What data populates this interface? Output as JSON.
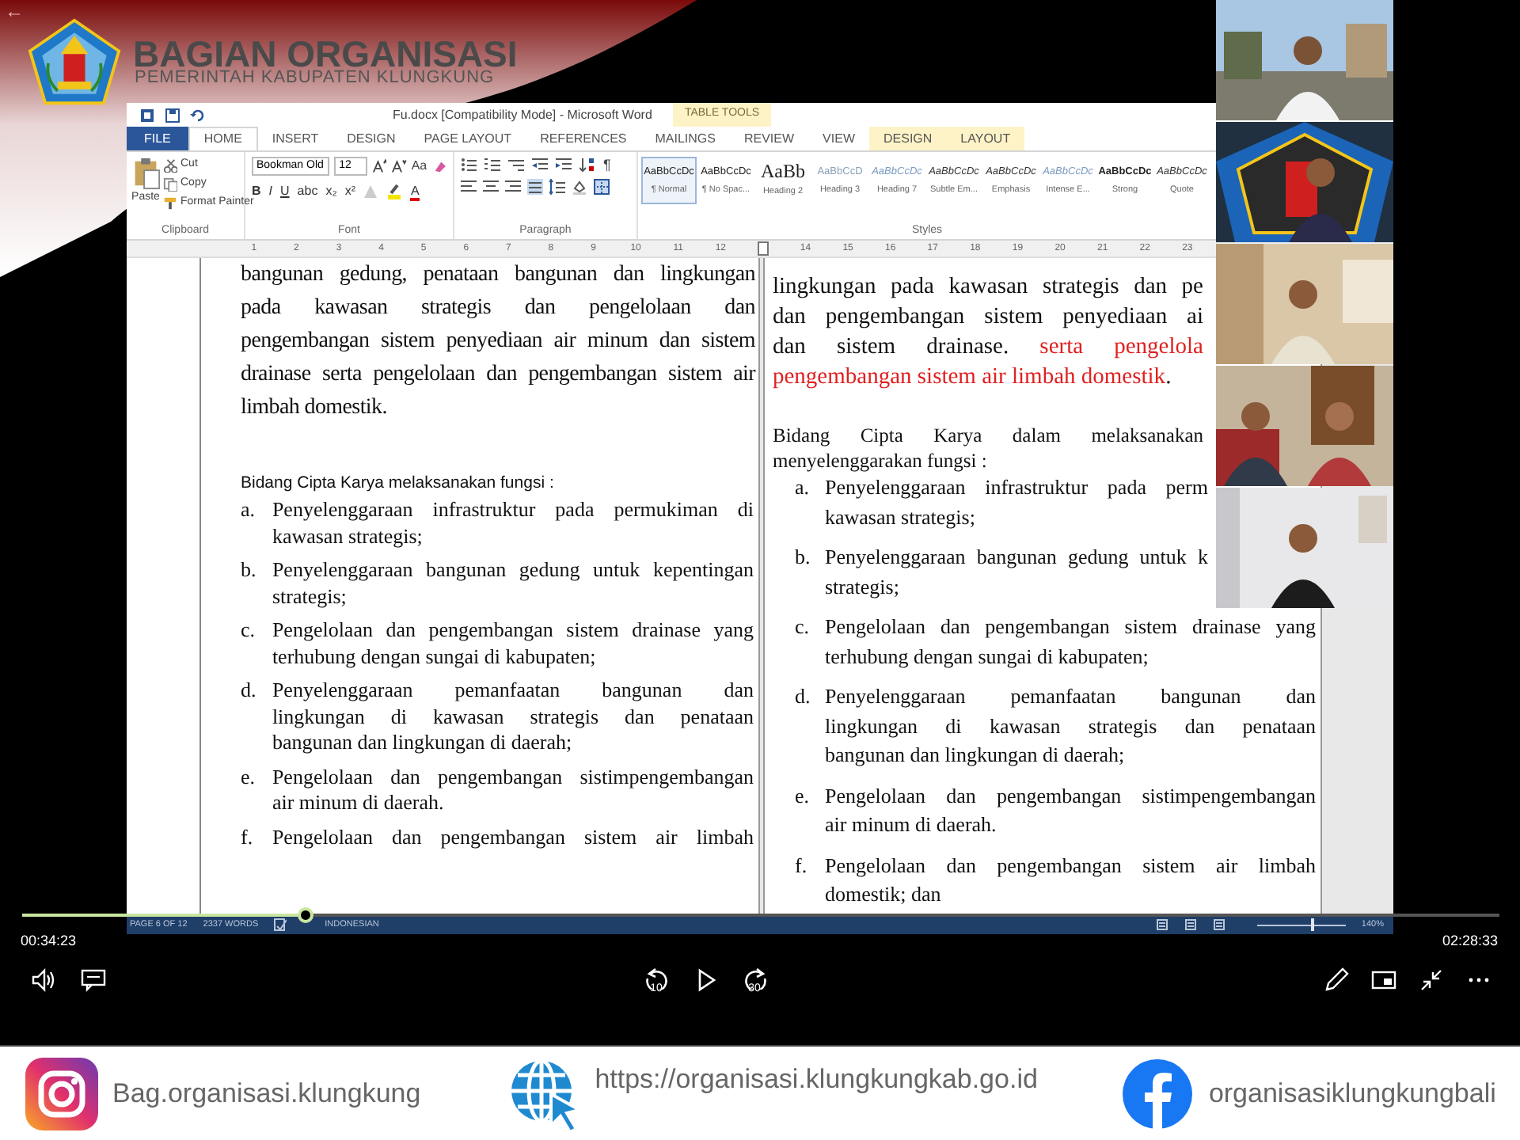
{
  "header": {
    "back": "←",
    "title": "BAGIAN ORGANISASI",
    "subtitle": "PEMERINTAH KABUPATEN KLUNGKUNG"
  },
  "word": {
    "title": "Fu.docx [Compatibility Mode] - Microsoft Word",
    "context_label": "TABLE TOOLS",
    "tabs": [
      {
        "label": "FILE",
        "kind": "file",
        "selected": false
      },
      {
        "label": "HOME",
        "kind": "tab",
        "selected": true
      },
      {
        "label": "INSERT",
        "kind": "tab",
        "selected": false
      },
      {
        "label": "DESIGN",
        "kind": "tab",
        "selected": false
      },
      {
        "label": "PAGE LAYOUT",
        "kind": "tab",
        "selected": false
      },
      {
        "label": "REFERENCES",
        "kind": "tab",
        "selected": false
      },
      {
        "label": "MAILINGS",
        "kind": "tab",
        "selected": false
      },
      {
        "label": "REVIEW",
        "kind": "tab",
        "selected": false
      },
      {
        "label": "VIEW",
        "kind": "tab",
        "selected": false
      },
      {
        "label": "DESIGN",
        "kind": "context",
        "selected": false
      },
      {
        "label": "LAYOUT",
        "kind": "context",
        "selected": false
      }
    ],
    "clipboard": {
      "paste": "Paste",
      "cut": "Cut",
      "copy": "Copy",
      "format_painter": "Format Painter",
      "label": "Clipboard"
    },
    "font": {
      "name": "Bookman Old",
      "size": "12",
      "change_case": "Aa",
      "format_buttons": [
        "B",
        "I",
        "U",
        "abc",
        "x₂",
        "x²"
      ],
      "font_color": "A",
      "label": "Font"
    },
    "paragraph": {
      "show_marks": "¶",
      "label": "Paragraph"
    },
    "styles": {
      "label": "Styles",
      "items": [
        {
          "preview": "AaBbCcDc",
          "name": "¶ Normal",
          "kind": "normal",
          "selected": true
        },
        {
          "preview": "AaBbCcDc",
          "name": "¶ No Spac...",
          "kind": "normal",
          "selected": false
        },
        {
          "preview": "AaBb",
          "name": "Heading 2",
          "kind": "heading",
          "selected": false
        },
        {
          "preview": "AaBbCcD",
          "name": "Heading 3",
          "kind": "light",
          "selected": false
        },
        {
          "preview": "AaBbCcDc",
          "name": "Heading 7",
          "kind": "italic-light",
          "selected": false
        },
        {
          "preview": "AaBbCcDc",
          "name": "Subtle Em...",
          "kind": "italic",
          "selected": false
        },
        {
          "preview": "AaBbCcDc",
          "name": "Emphasis",
          "kind": "italic",
          "selected": false
        },
        {
          "preview": "AaBbCcDc",
          "name": "Intense E...",
          "kind": "italic-light",
          "selected": false
        },
        {
          "preview": "AaBbCcDc",
          "name": "Strong",
          "kind": "strong",
          "selected": false
        },
        {
          "preview": "AaBbCcDc",
          "name": "Quote",
          "kind": "italic",
          "selected": false
        }
      ]
    },
    "ruler": [
      {
        "kind": "number",
        "label": "1"
      },
      {
        "kind": "number",
        "label": "2"
      },
      {
        "kind": "number",
        "label": "3"
      },
      {
        "kind": "number",
        "label": "4"
      },
      {
        "kind": "number",
        "label": "5"
      },
      {
        "kind": "number",
        "label": "6"
      },
      {
        "kind": "number",
        "label": "7"
      },
      {
        "kind": "number",
        "label": "8"
      },
      {
        "kind": "number",
        "label": "9"
      },
      {
        "kind": "number",
        "label": "10"
      },
      {
        "kind": "number",
        "label": "11"
      },
      {
        "kind": "number",
        "label": "12"
      },
      {
        "kind": "marker"
      },
      {
        "kind": "number",
        "label": "14"
      },
      {
        "kind": "number",
        "label": "15"
      },
      {
        "kind": "number",
        "label": "16"
      },
      {
        "kind": "number",
        "label": "17"
      },
      {
        "kind": "number",
        "label": "18"
      },
      {
        "kind": "number",
        "label": "19"
      },
      {
        "kind": "number",
        "label": "20"
      },
      {
        "kind": "number",
        "label": "21"
      },
      {
        "kind": "number",
        "label": "22"
      },
      {
        "kind": "number",
        "label": "23"
      }
    ],
    "left_page": {
      "paragraph": [
        "bangunan gedung, penataan bangunan dan lingkungan",
        "pada kawasan strategis dan pengelolaan dan",
        "pengembangan sistem penyediaan air minum dan sistem",
        "drainase serta pengelolaan dan pengembangan sistem air",
        "limbah domestik."
      ],
      "heading": "Bidang Cipta Karya melaksanakan fungsi :",
      "items": [
        {
          "letter": "a.",
          "lines": [
            "Penyelenggaraan infrastruktur pada permukiman di",
            "kawasan strategis;"
          ]
        },
        {
          "letter": "b.",
          "lines": [
            "Penyelenggaraan bangunan gedung untuk kepentingan",
            "strategis;"
          ]
        },
        {
          "letter": "c.",
          "lines": [
            "Pengelolaan dan pengembangan sistem drainase yang",
            "terhubung dengan sungai di kabupaten;"
          ]
        },
        {
          "letter": "d.",
          "lines": [
            "Penyelenggaraan pemanfaatan bangunan dan",
            "lingkungan di kawasan strategis dan penataan",
            "bangunan dan lingkungan di daerah;"
          ]
        },
        {
          "letter": "e.",
          "lines": [
            "Pengelolaan dan pengembangan sistimpengembangan",
            "air minum di daerah."
          ]
        },
        {
          "letter": "f.",
          "lines": [
            "Pengelolaan dan pengembangan sistem air limbah"
          ]
        }
      ]
    },
    "right_page": {
      "paragraph": [
        {
          "cut": true,
          "parts": [
            {
              "kind": "plain",
              "text": "lingkungan pada kawasan strategis dan pe"
            }
          ]
        },
        {
          "cut": true,
          "parts": [
            {
              "kind": "plain",
              "text": "dan pengembangan sistem penyediaan ai"
            }
          ]
        },
        {
          "cut": true,
          "parts": [
            {
              "kind": "plain",
              "text": "dan sistem drainase."
            },
            {
              "kind": "red",
              "text": "serta pengelola"
            }
          ]
        },
        {
          "cut": false,
          "parts": [
            {
              "kind": "red",
              "text": "pengembangan sistem air limbah domestik"
            },
            {
              "kind": "plain",
              "text": "."
            }
          ]
        }
      ],
      "heading": [
        {
          "cut": true,
          "text": "Bidang Cipta Karya dalam melaksanakan"
        },
        {
          "cut": false,
          "text": "menyelenggarakan fungsi :"
        }
      ],
      "items": [
        {
          "letter": "a.",
          "lines": [
            {
              "cut": true,
              "text": "Penyelenggaraan infrastruktur pada perm"
            },
            {
              "cut": false,
              "text": "kawasan strategis;"
            }
          ]
        },
        {
          "letter": "b.",
          "lines": [
            {
              "cut": true,
              "text": "Penyelenggaraan bangunan gedung untuk k"
            },
            {
              "cut": false,
              "text": "strategis;"
            }
          ]
        },
        {
          "letter": "c.",
          "lines": [
            {
              "cut": false,
              "text": "Pengelolaan dan pengembangan sistem drainase yang"
            },
            {
              "cut": false,
              "text": "terhubung dengan sungai di kabupaten;"
            }
          ]
        },
        {
          "letter": "d.",
          "lines": [
            {
              "cut": false,
              "text": "Penyelenggaraan pemanfaatan bangunan dan"
            },
            {
              "cut": false,
              "text": "lingkungan di kawasan strategis dan penataan"
            },
            {
              "cut": false,
              "text": "bangunan dan lingkungan di daerah;"
            }
          ]
        },
        {
          "letter": "e.",
          "lines": [
            {
              "cut": false,
              "text": "Pengelolaan dan pengembangan sistimpengembangan"
            },
            {
              "cut": false,
              "text": "air minum di daerah."
            }
          ]
        },
        {
          "letter": "f.",
          "lines": [
            {
              "cut": false,
              "text": "Pengelolaan dan pengembangan sistem air limbah"
            },
            {
              "cut": false,
              "text": "domestik; dan"
            }
          ]
        }
      ]
    },
    "status_bar": {
      "page": "PAGE 6 OF 12",
      "words": "2337 WORDS",
      "language": "INDONESIAN",
      "zoom": {
        "reading": "140%",
        "level": 0.6
      }
    }
  },
  "video_tiles": [
    {
      "kind": "outdoor"
    },
    {
      "kind": "emblem"
    },
    {
      "kind": "indoor"
    },
    {
      "kind": "room"
    },
    {
      "kind": "wall"
    }
  ],
  "player": {
    "elapsed": "00:34:23",
    "total": "02:28:33",
    "level": 0.192,
    "skip_back": "10",
    "skip_forward": "30"
  },
  "footer": [
    {
      "kind": "instagram",
      "text": "Bag.organisasi.klungkung"
    },
    {
      "kind": "web",
      "text": "https://organisasi.klungkungkab.go.id"
    },
    {
      "kind": "facebook",
      "text": "organisasiklungkungbali"
    }
  ]
}
